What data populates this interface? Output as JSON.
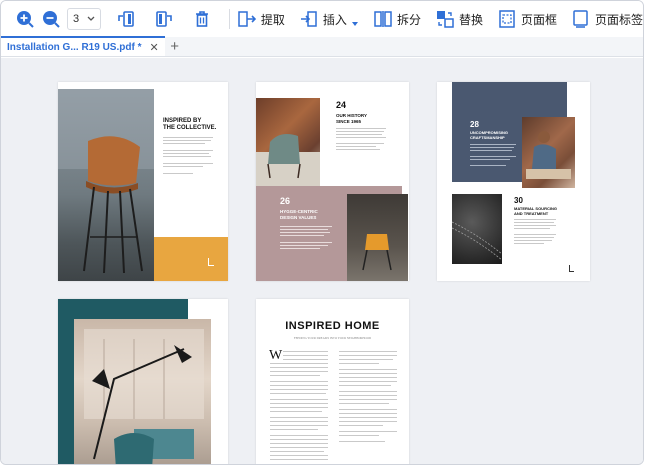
{
  "toolbar": {
    "zoom_in": "zoom-in",
    "zoom_out": "zoom-out",
    "page_value": "3",
    "extract_label": "提取",
    "insert_label": "插入",
    "split_label": "拆分",
    "replace_label": "替换",
    "page_box_label": "页面框",
    "page_label_label": "页面标签"
  },
  "tabs": [
    {
      "label": "Installation  G... R19 US.pdf *",
      "close": "✕"
    }
  ],
  "tab_add": "+",
  "pages": {
    "p1": {
      "heading_line1": "INSPIRED BY",
      "heading_line2": "THE COLLECTIVE."
    },
    "p2": {
      "number": "24",
      "heading_line1": "OUR HISTORY",
      "heading_line2": "SINCE 1965",
      "number2": "26",
      "heading2_line1": "HYGGE-CENTRIC",
      "heading2_line2": "DESIGN VALUES"
    },
    "p3": {
      "number": "28",
      "heading_line1": "UNCOMPROMISING",
      "heading_line2": "CRAFTSMANSHIP",
      "number2": "30",
      "heading2_line1": "MATERIAL SOURCING",
      "heading2_line2": "AND TREATMENT"
    },
    "p5": {
      "title": "INSPIRED HOME",
      "subtitle": "FEEDING YOUR DREAMS INTO YOUR NEIGHBORHOOD",
      "dropcap": "W"
    }
  },
  "colors": {
    "accent": "#2f6fd6",
    "icon_blue": "#2f6fd6",
    "page_orange": "#e8a640",
    "page_slate": "#4a5870",
    "page_mauve": "#b49899",
    "page_teal": "#1f5a63"
  }
}
